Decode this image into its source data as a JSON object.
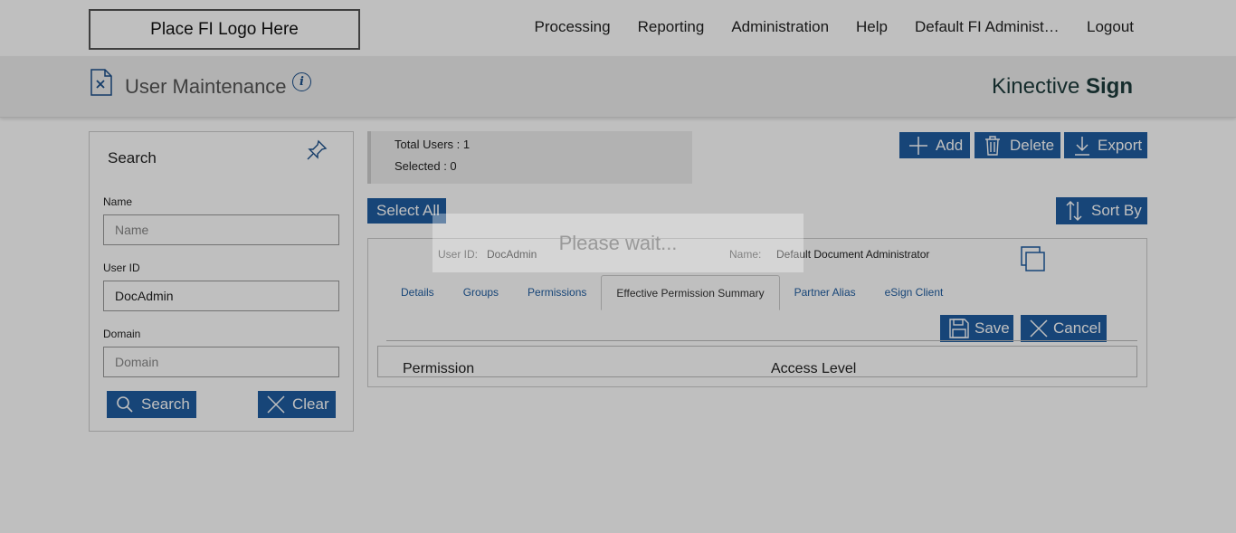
{
  "topbar": {
    "logo_text": "Place FI Logo Here",
    "nav": [
      "Processing",
      "Reporting",
      "Administration",
      "Help",
      "Default FI Administr...",
      "Logout"
    ]
  },
  "header": {
    "title": "User Maintenance",
    "info_icon": "i",
    "brand_regular": "Kinective ",
    "brand_bold": "Sign"
  },
  "search": {
    "title": "Search",
    "name_label": "Name",
    "name_placeholder": "Name",
    "userid_label": "User ID",
    "userid_value": "DocAdmin",
    "domain_label": "Domain",
    "domain_placeholder": "Domain",
    "search_button": "Search",
    "clear_button": "Clear"
  },
  "totals": {
    "total_users": "Total Users : 1",
    "selected": "Selected : 0"
  },
  "actions": {
    "add": "Add",
    "delete": "Delete",
    "export": "Export",
    "select_all": "Select All",
    "sort_by": "Sort By"
  },
  "user": {
    "userid_label": "User ID:",
    "userid_value": "DocAdmin",
    "name_label": "Name:",
    "name_value": "Default Document Administrator"
  },
  "tabs": [
    "Details",
    "Groups",
    "Permissions",
    "Effective Permission Summary",
    "Partner Alias",
    "eSign Client"
  ],
  "form_actions": {
    "save": "Save",
    "cancel": "Cancel"
  },
  "table": {
    "col1": "Permission",
    "col2": "Access Level"
  },
  "overlay": {
    "message": "Please wait..."
  },
  "colors": {
    "primary": "#1f5da0",
    "overlay": "rgba(0,0,0,0.25)"
  }
}
